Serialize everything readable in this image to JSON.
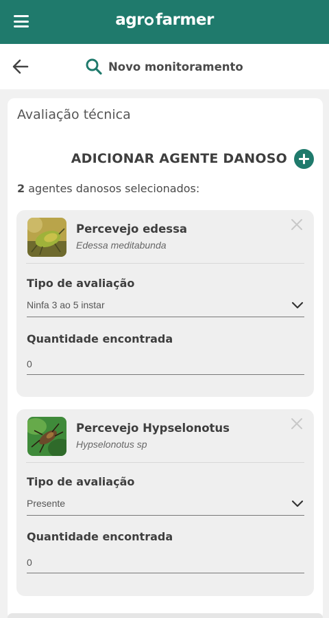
{
  "app": {
    "logo_left": "agr",
    "logo_right": "farmer"
  },
  "header": {
    "title": "Novo monitoramento"
  },
  "section": {
    "title": "Avaliação técnica",
    "add_label": "ADICIONAR AGENTE DANOSO",
    "count": "2",
    "count_suffix": "agentes danosos selecionados:"
  },
  "agents": [
    {
      "name": "Percevejo edessa",
      "scientific": "Edessa meditabunda",
      "type_label": "Tipo de avaliação",
      "type_value": "Ninfa 3 ao 5 instar",
      "qty_label": "Quantidade encontrada",
      "qty_value": "0"
    },
    {
      "name": "Percevejo Hypselonotus",
      "scientific": "Hypselonotus sp",
      "type_label": "Tipo de avaliação",
      "type_value": "Presente",
      "qty_label": "Quantidade encontrada",
      "qty_value": "0"
    }
  ],
  "colors": {
    "brand": "#1f7a6c",
    "card_bg": "#efefef",
    "page_bg": "#f1f1f1"
  },
  "icons": [
    "menu-icon",
    "back-arrow-icon",
    "search-icon",
    "add-circle-icon",
    "close-icon",
    "chevron-down-icon"
  ]
}
